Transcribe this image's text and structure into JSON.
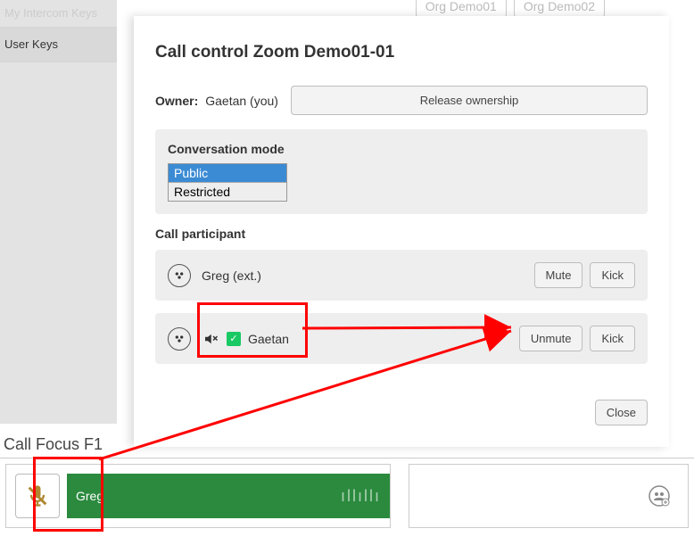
{
  "sidebar": {
    "item1": "My Intercom Keys",
    "item2": "User Keys"
  },
  "top_tabs": {
    "tab1": "Org Demo01",
    "tab2": "Org Demo02"
  },
  "modal": {
    "title": "Call control Zoom Demo01-01",
    "owner_label": "Owner:",
    "owner_value": "Gaetan  (you)",
    "release_btn": "Release ownership",
    "conv_mode_title": "Conversation mode",
    "conv_mode_options": {
      "opt1": "Public",
      "opt2": "Restricted"
    },
    "conv_mode_selected": "Public",
    "participant_title": "Call participant",
    "p1": {
      "name": "Greg (ext.)",
      "mute_btn": "Mute",
      "kick_btn": "Kick"
    },
    "p2": {
      "name": "Gaetan",
      "mute_btn": "Unmute",
      "kick_btn": "Kick"
    },
    "close_btn": "Close"
  },
  "footer": {
    "title": "Call Focus F1",
    "name": "Greg"
  }
}
